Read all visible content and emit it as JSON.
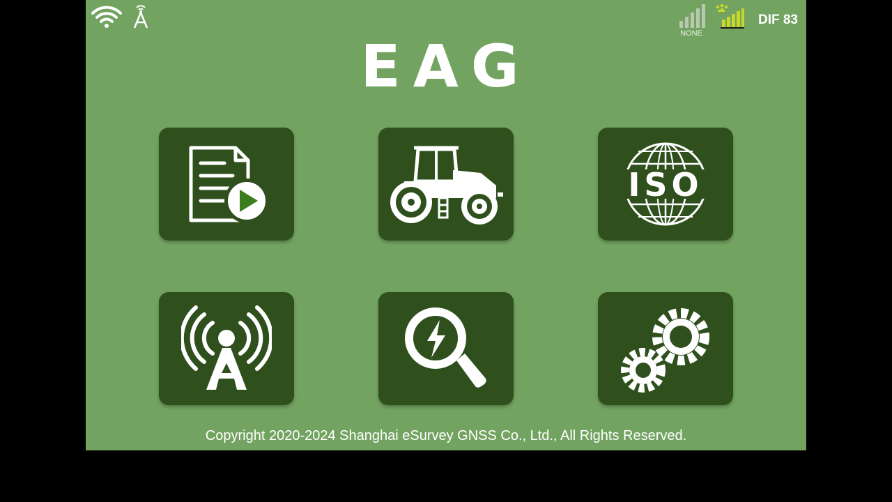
{
  "status_bar": {
    "wifi_icon": "wifi-icon",
    "antenna_icon": "antenna-icon",
    "signal_label": "NONE",
    "satellite_icon": "satellite-signal-icon",
    "dif_text": "DIF 83"
  },
  "app": {
    "title": "EAG"
  },
  "tiles": [
    {
      "icon": "document-play-icon"
    },
    {
      "icon": "tractor-icon"
    },
    {
      "icon": "iso-globe-icon",
      "text": "ISO"
    },
    {
      "icon": "radio-tower-icon"
    },
    {
      "icon": "diagnostics-search-icon"
    },
    {
      "icon": "settings-gears-icon"
    }
  ],
  "footer": {
    "copyright": "Copyright 2020-2024 Shanghai eSurvey GNSS Co., Ltd., All Rights Reserved."
  },
  "colors": {
    "background": "#72a360",
    "tile": "#2f4f1d",
    "letterbox": "#000000",
    "icon": "#ffffff",
    "play_green": "#3a7d1e"
  }
}
